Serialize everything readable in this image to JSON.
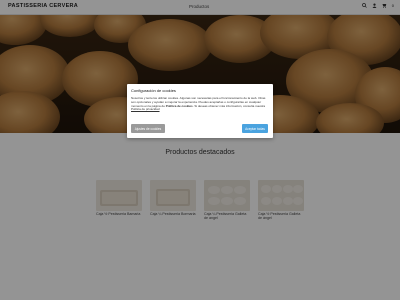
{
  "header": {
    "logo_text": "PASTISSERIA CERVERA",
    "nav_link": "Productos",
    "icons": [
      "search-icon",
      "user-icon",
      "cart-icon"
    ],
    "cart_count": "0"
  },
  "hero": {
    "image": "ensaimada-pastries-photo"
  },
  "featured": {
    "title": "Productos destacados",
    "products": [
      {
        "name": "Caja ½ Pestisseria Bamaria"
      },
      {
        "name": "Caja ¼ Pestisseria Bormaria"
      },
      {
        "name": "Caja ¼ Pestisseria Galleta de angel"
      },
      {
        "name": "Caja ½ Pestisseria Galleta de ángel"
      }
    ]
  },
  "cookie_modal": {
    "title": "Configuración de cookies",
    "text_1": "Nosotros y terceros utilizan cookies. Algunas son necesarias para el funcionamiento de la web. Otras son opcionales y ayudan a mejorar la experiencia. Puedes aceptarlas o configurarlas en cualquier momento en la página de",
    "policy_link": "Política de cookies",
    "text_2": ". Si deseas obtener más información, consulta nuestra",
    "privacy_link": "Política de privacidad",
    "settings_button": "Ajustes de cookies",
    "accept_button": "Aceptar todas"
  },
  "colors": {
    "overlay": "#000000",
    "accept": "#4aa3df",
    "settings": "#9a9a9a"
  }
}
